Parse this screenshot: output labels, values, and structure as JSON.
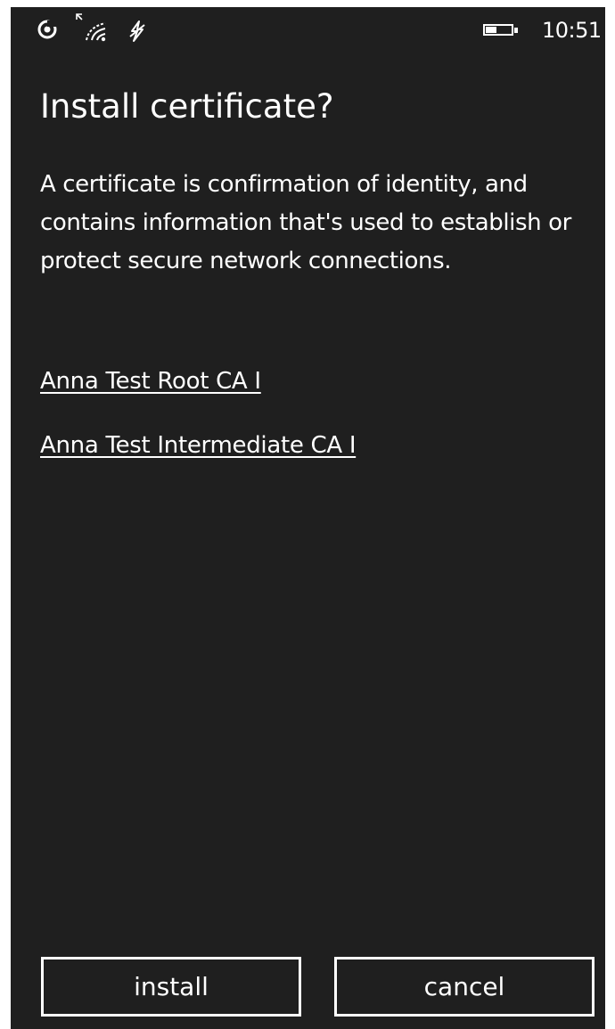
{
  "status_bar": {
    "time": "10:51",
    "icons": [
      "sync-icon",
      "signal-icon",
      "wifi-icon",
      "data-icon",
      "battery-icon"
    ]
  },
  "dialog": {
    "title": "Install certificate?",
    "description": "A certificate is confirmation of identity, and contains information that's used to establish or protect secure network connections.",
    "certificates": [
      "Anna Test Root CA I",
      "Anna Test Intermediate CA I"
    ]
  },
  "buttons": {
    "install_label": "install",
    "cancel_label": "cancel"
  },
  "colors": {
    "background": "#1f1f1f",
    "foreground": "#ffffff"
  }
}
